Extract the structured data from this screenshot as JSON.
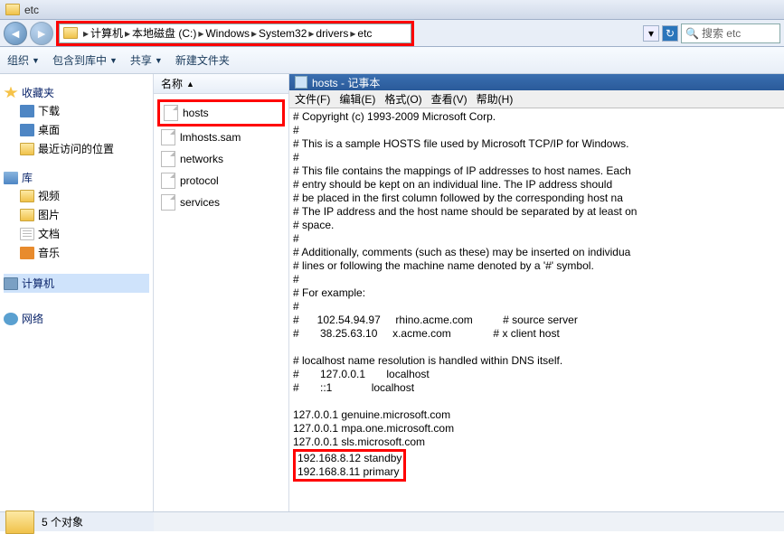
{
  "window": {
    "title": "etc"
  },
  "nav": {
    "path": [
      "计算机",
      "本地磁盘 (C:)",
      "Windows",
      "System32",
      "drivers",
      "etc"
    ],
    "search_placeholder": "搜索 etc"
  },
  "toolbar": {
    "organize": "组织",
    "include": "包含到库中",
    "share": "共享",
    "newfolder": "新建文件夹"
  },
  "left": {
    "favorites": "收藏夹",
    "downloads": "下载",
    "desktop": "桌面",
    "recent": "最近访问的位置",
    "libs": "库",
    "video": "视频",
    "pictures": "图片",
    "docs": "文档",
    "music": "音乐",
    "computer": "计算机",
    "network": "网络"
  },
  "mid": {
    "col_name": "名称",
    "files": [
      "hosts",
      "lmhosts.sam",
      "networks",
      "protocol",
      "services"
    ]
  },
  "status": {
    "count": "5 个对象"
  },
  "notepad": {
    "title": "hosts - 记事本",
    "menus": [
      "文件(F)",
      "编辑(E)",
      "格式(O)",
      "查看(V)",
      "帮助(H)"
    ],
    "content_top": "# Copyright (c) 1993-2009 Microsoft Corp.\n#\n# This is a sample HOSTS file used by Microsoft TCP/IP for Windows.\n#\n# This file contains the mappings of IP addresses to host names. Each\n# entry should be kept on an individual line. The IP address should\n# be placed in the first column followed by the corresponding host na\n# The IP address and the host name should be separated by at least on\n# space.\n#\n# Additionally, comments (such as these) may be inserted on individua\n# lines or following the machine name denoted by a '#' symbol.\n#\n# For example:\n#\n#      102.54.94.97     rhino.acme.com          # source server\n#       38.25.63.10     x.acme.com              # x client host\n\n# localhost name resolution is handled within DNS itself.\n#       127.0.0.1       localhost\n#       ::1             localhost\n\n127.0.0.1 genuine.microsoft.com\n127.0.0.1 mpa.one.microsoft.com\n127.0.0.1 sls.microsoft.com",
    "content_hl": "192.168.8.12 standby\n192.168.8.11 primary"
  }
}
